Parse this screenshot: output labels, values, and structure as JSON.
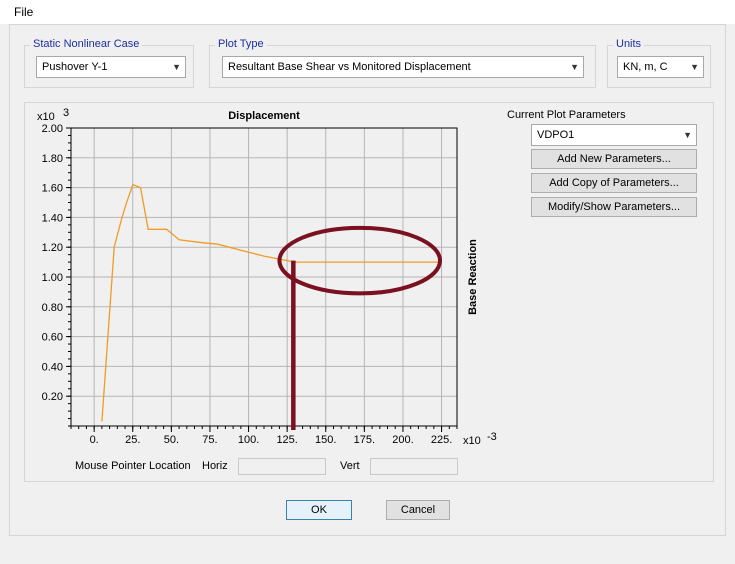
{
  "menu": {
    "file_label": "File"
  },
  "static_case": {
    "title": "Static Nonlinear Case",
    "value": "Pushover Y-1"
  },
  "plot_type": {
    "title": "Plot Type",
    "value": "Resultant Base Shear vs Monitored Displacement"
  },
  "units": {
    "title": "Units",
    "value": "KN, m, C"
  },
  "plot_params": {
    "title": "Current Plot Parameters",
    "selected": "VDPO1",
    "add_new_label": "Add New Parameters...",
    "add_copy_label": "Add Copy of Parameters...",
    "modify_label": "Modify/Show Parameters..."
  },
  "mouse": {
    "label": "Mouse Pointer Location",
    "horiz_label": "Horiz",
    "vert_label": "Vert"
  },
  "buttons": {
    "ok_label": "OK",
    "cancel_label": "Cancel"
  },
  "colors": {
    "curve": "#f29a26",
    "annotation": "#7a1020",
    "group_title": "#1c2fa0"
  },
  "chart_data": {
    "type": "line",
    "title": "Displacement",
    "xlabel": "",
    "ylabel": "Base Reaction",
    "x_scale_label": "x10",
    "x_scale_exp": "-3",
    "y_scale_label": "x10",
    "y_scale_exp": "3",
    "xlim": [
      -15,
      235
    ],
    "ylim": [
      0,
      2.0
    ],
    "x_ticks": [
      0,
      25,
      50,
      75,
      100,
      125,
      150,
      175,
      200,
      225
    ],
    "x_tick_labels": [
      "0.",
      "25.",
      "50.",
      "75.",
      "100.",
      "125.",
      "150.",
      "175.",
      "200.",
      "225."
    ],
    "y_ticks": [
      0.2,
      0.4,
      0.6,
      0.8,
      1.0,
      1.2,
      1.4,
      1.6,
      1.8,
      2.0
    ],
    "y_tick_labels": [
      "0.20",
      "0.40",
      "0.60",
      "0.80",
      "1.00",
      "1.20",
      "1.40",
      "1.60",
      "1.80",
      "2.00"
    ],
    "grid": true,
    "series": [
      {
        "x": [
          5,
          13,
          18,
          21,
          25,
          30,
          35,
          47,
          55,
          70,
          80,
          95,
          110,
          125,
          130,
          150,
          175,
          200,
          225
        ],
        "y": [
          0.03,
          1.2,
          1.4,
          1.5,
          1.62,
          1.6,
          1.32,
          1.32,
          1.25,
          1.23,
          1.22,
          1.18,
          1.14,
          1.11,
          1.1,
          1.1,
          1.1,
          1.1,
          1.1
        ]
      }
    ],
    "annotations": [
      {
        "type": "ellipse",
        "cx": 172,
        "cy": 1.11,
        "rx": 52,
        "ry": 0.22
      },
      {
        "type": "vline",
        "x": 129,
        "y_top": 1.11,
        "y_bottom": 0
      }
    ]
  }
}
